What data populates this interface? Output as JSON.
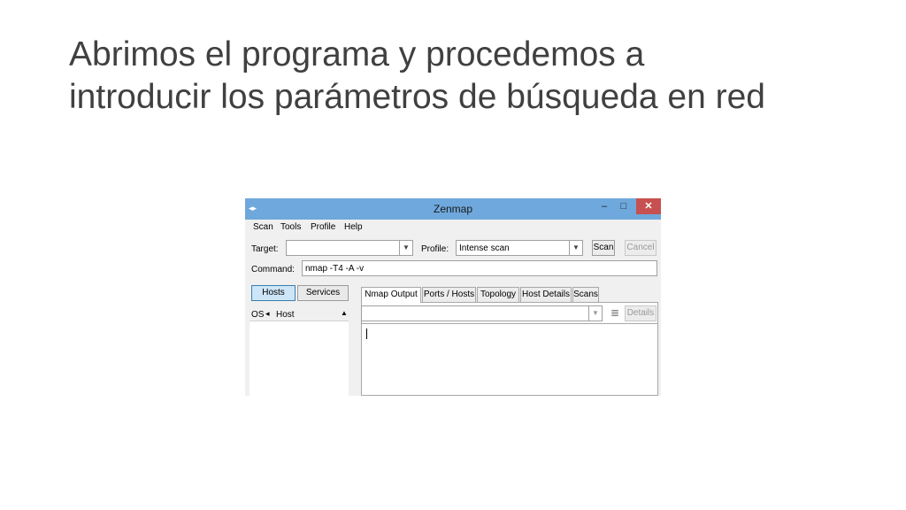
{
  "slide": {
    "title_line1": "Abrimos el programa y procedemos a",
    "title_line2": "introducir los parámetros de búsqueda en red"
  },
  "window": {
    "title": "Zenmap",
    "icon": "zenmap-icon",
    "controls": {
      "minimize": "–",
      "maximize": "□",
      "close": "✕"
    },
    "colors": {
      "titlebar": "#6fa8dc",
      "close": "#c75050"
    }
  },
  "menu": {
    "scan": "Scan",
    "tools": "Tools",
    "profile": "Profile",
    "help": "Help"
  },
  "toolbar": {
    "target_label": "Target:",
    "target_value": "",
    "profile_label": "Profile:",
    "profile_value": "Intense scan",
    "scan_button": "Scan",
    "cancel_button": "Cancel",
    "command_label": "Command:",
    "command_value": "nmap -T4 -A -v"
  },
  "left_panel": {
    "hosts_button": "Hosts",
    "services_button": "Services",
    "col_os": "OS",
    "col_os_sort": "◂",
    "col_host": "Host",
    "col_host_sort": "▲"
  },
  "tabs": [
    "Nmap Output",
    "Ports / Hosts",
    "Topology",
    "Host Details",
    "Scans"
  ],
  "output": {
    "selector_value": "",
    "filter_icon": "≣",
    "details_button": "Details"
  }
}
